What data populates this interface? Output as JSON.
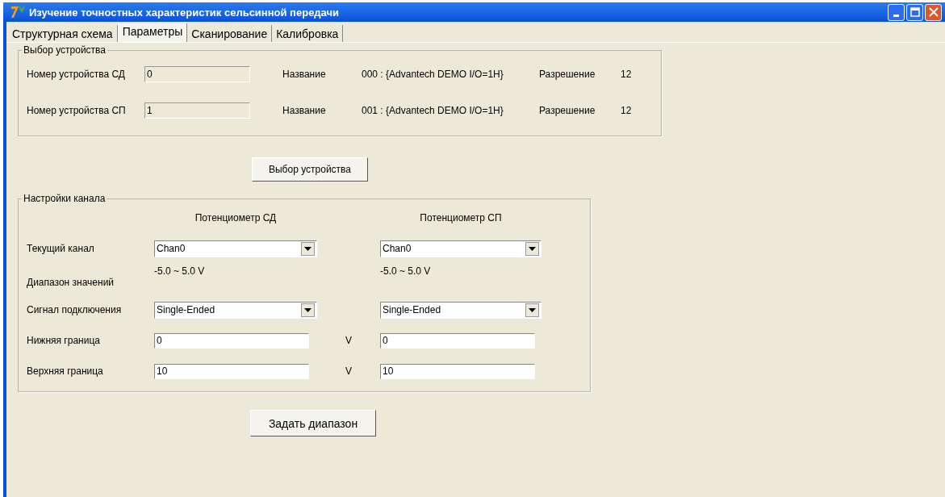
{
  "window": {
    "title": "Изучение точностных характеристик сельсинной передачи"
  },
  "tabs": [
    {
      "label": "Структурная схема",
      "selected": false
    },
    {
      "label": "Параметры",
      "selected": true
    },
    {
      "label": "Сканирование",
      "selected": false
    },
    {
      "label": "Калибровка",
      "selected": false
    }
  ],
  "device_group": {
    "title": "Выбор устройства",
    "rows": [
      {
        "label": "Номер устройства СД",
        "value": "0",
        "name_label": "Название",
        "name_value": "000 : {Advantech DEMO I/O=1H}",
        "resolution_label": "Разрешение",
        "resolution_value": "12"
      },
      {
        "label": "Номер устройства СП",
        "value": "1",
        "name_label": "Название",
        "name_value": "001 : {Advantech DEMO I/O=1H}",
        "resolution_label": "Разрешение",
        "resolution_value": "12"
      }
    ]
  },
  "select_device_button": "Выбор устройства",
  "channel_group": {
    "title": "Настройки канала",
    "columns": [
      "Потенциометр СД",
      "Потенциометр СП"
    ],
    "rows": [
      {
        "kind": "combo",
        "label": "Текущий канал",
        "values": [
          "Chan0",
          "Chan0"
        ]
      },
      {
        "kind": "text",
        "label": "Диапазон значений",
        "values": [
          "-5.0 ~ 5.0 V",
          "-5.0 ~ 5.0 V"
        ]
      },
      {
        "kind": "combo",
        "label": "Сигнал подключения",
        "values": [
          "Single-Ended",
          "Single-Ended"
        ]
      },
      {
        "kind": "input",
        "label": "Нижняя граница",
        "unit": "V",
        "values": [
          "0",
          "0"
        ]
      },
      {
        "kind": "input",
        "label": "Верхняя граница",
        "unit": "V",
        "values": [
          "10",
          "10"
        ]
      }
    ]
  },
  "set_range_button": "Задать диапазон"
}
